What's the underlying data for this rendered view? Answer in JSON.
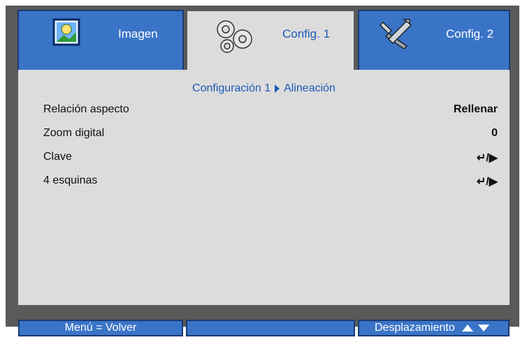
{
  "tabs": [
    {
      "label": "Imagen",
      "icon": "image-icon",
      "active": false
    },
    {
      "label": "Config. 1",
      "icon": "gears-icon",
      "active": true
    },
    {
      "label": "Config. 2",
      "icon": "tools-icon",
      "active": false
    }
  ],
  "breadcrumb": {
    "parent": "Configuración 1",
    "current": "Alineación"
  },
  "menu": [
    {
      "label": "Relación aspecto",
      "value": "Rellenar"
    },
    {
      "label": "Zoom digital",
      "value": "0"
    },
    {
      "label": "Clave",
      "value": "↵/▶"
    },
    {
      "label": "4 esquinas",
      "value": "↵/▶"
    }
  ],
  "footer": {
    "back": "Menú = Volver",
    "middle": "",
    "scroll": "Desplazamiento"
  },
  "colors": {
    "accent": "#3a74c7",
    "panel": "#dcdcdc",
    "frame": "#5a5a5a",
    "text_blue": "#1f5bb5"
  }
}
